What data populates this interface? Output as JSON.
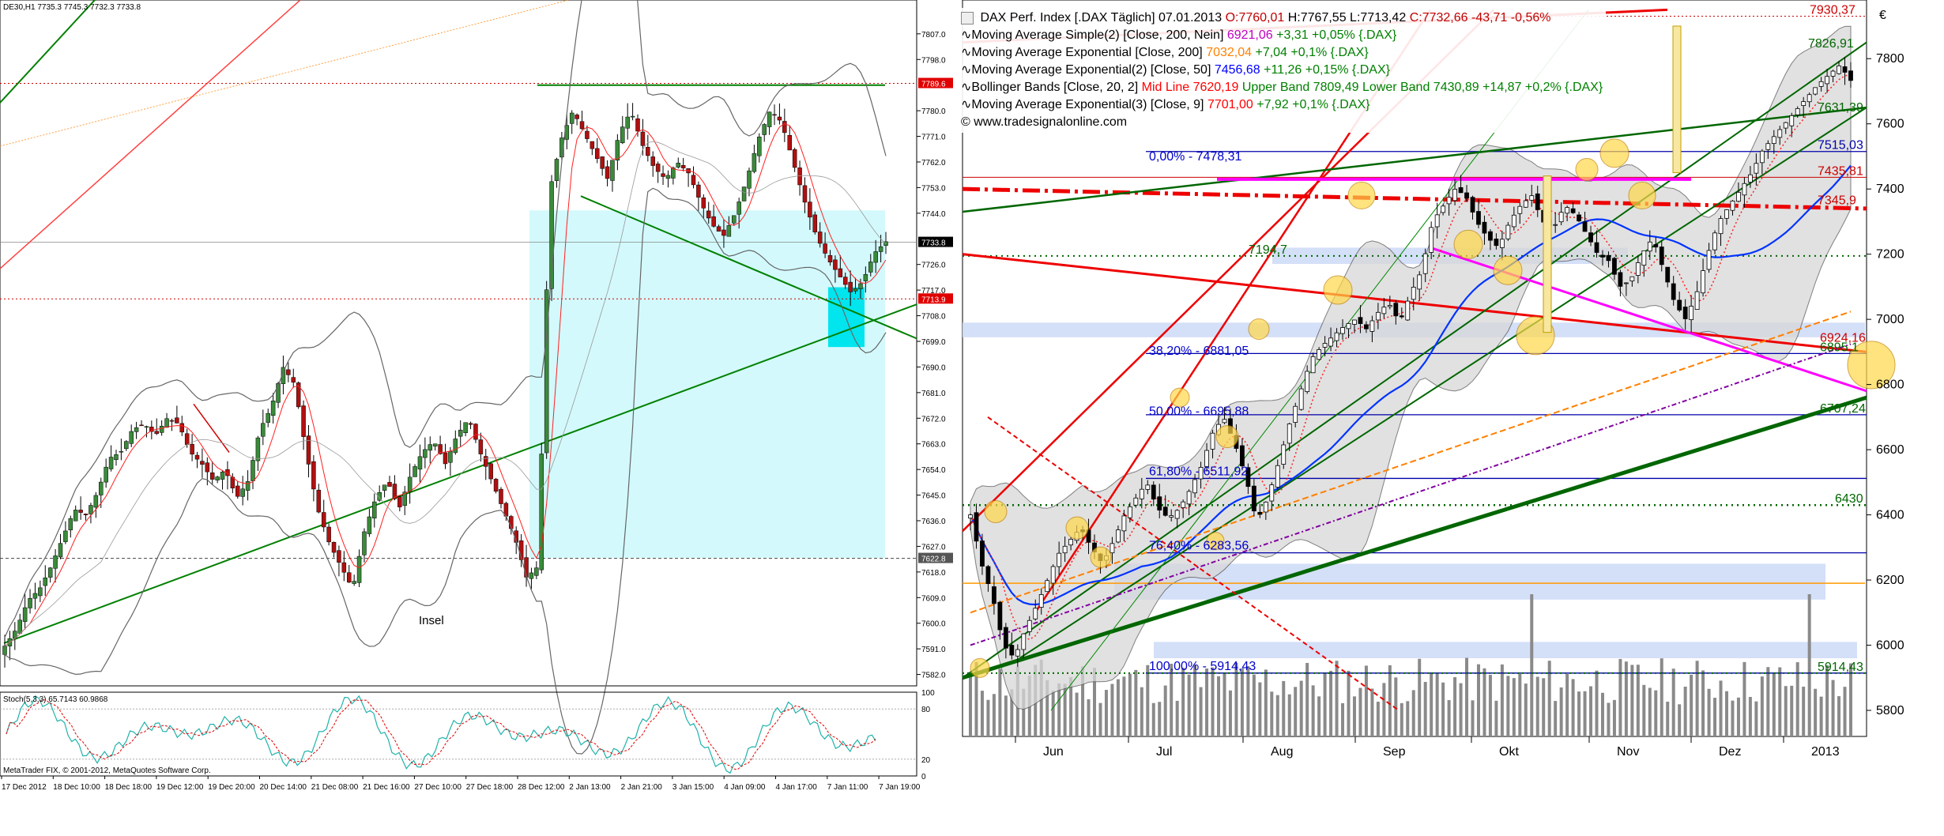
{
  "left": {
    "header": "DE30,H1  7735.3 7745.3 7732.3 7733.8",
    "annotation_insel": "Insel",
    "copyright": "MetaTrader FIX, © 2001-2012, MetaQuotes Software Corp.",
    "stoch_label": "Stoch(5,3,3) 65.7143 60.9868",
    "current_price_tag": "7733.8",
    "red_tag_top": "7789.6",
    "red_tag_mid": "7713.9",
    "gray_tag_low": "7622.8",
    "stoch_ticks": [
      "100",
      "80",
      "20",
      "0"
    ]
  },
  "right": {
    "legend_title": "DAX Perf. Index [.DAX  Täglich]  07.01.2013",
    "legend_ohlc": {
      "o": "O:7760,01",
      "h": "H:7767,55",
      "l": "L:7713,42",
      "c": "C:7732,66",
      "chg": "-43,71 -0,56%"
    },
    "legend_lines": [
      {
        "name": "Moving Average Simple(2) [Close, 200, Nein]",
        "value": "6921,06",
        "chg": "+3,31 +0,05% {.DAX}",
        "color": "#c000c0"
      },
      {
        "name": "Moving Average Exponential [Close, 200]",
        "value": "7032,04",
        "chg": "+7,04 +0,1% {.DAX}",
        "color": "#ff8000"
      },
      {
        "name": "Moving Average Exponential(2) [Close, 50]",
        "value": "7456,68",
        "chg": "+11,26 +0,15% {.DAX}",
        "color": "#0000ff"
      },
      {
        "name": "Bollinger Bands [Close, 20, 2]",
        "value": "Mid Line 7620,19",
        "chg": "Upper Band 7809,49 Lower Band 7430,89 +14,87 +0,2% {.DAX}",
        "color": "#ff0000"
      },
      {
        "name": "Moving Average Exponential(3) [Close, 9]",
        "value": "7701,00",
        "chg": "+7,92 +0,1% {.DAX}",
        "color": "#ff0000"
      }
    ],
    "website": "www.tradesignalonline.com",
    "euro": "€",
    "level_labels": [
      {
        "text": "7930,37",
        "color": "#cc0000"
      },
      {
        "text": "7826,91",
        "color": "#006600"
      },
      {
        "text": "7631,39",
        "color": "#006600"
      },
      {
        "text": "7515,03",
        "color": "#0000aa"
      },
      {
        "text": "7435,81",
        "color": "#cc0000"
      },
      {
        "text": "7345,9",
        "color": "#cc0000"
      },
      {
        "text": "6924,16",
        "color": "#cc0000"
      },
      {
        "text": "6895,1",
        "color": "#006600"
      },
      {
        "text": "6707,24",
        "color": "#006600"
      },
      {
        "text": "6430",
        "color": "#006600"
      },
      {
        "text": "5914,43",
        "color": "#006600"
      },
      {
        "text": "7194,7",
        "color": "#006600"
      }
    ],
    "fib_labels": [
      "0,00% - 7478,31",
      "38,20% - 6881,05",
      "50,00% - 6695,88",
      "61,80% - 6511,92",
      "76,40% - 6283,56",
      "100,00% - 5914,43"
    ]
  },
  "chart_data": [
    {
      "type": "candlestick",
      "title": "DE30,H1",
      "x_labels": [
        "17 Dec 2012",
        "18 Dec 10:00",
        "18 Dec 18:00",
        "19 Dec 12:00",
        "19 Dec 20:00",
        "20 Dec 14:00",
        "21 Dec 08:00",
        "21 Dec 16:00",
        "27 Dec 10:00",
        "27 Dec 18:00",
        "28 Dec 12:00",
        "2 Jan 13:00",
        "2 Jan 21:00",
        "3 Jan 15:00",
        "4 Jan 09:00",
        "4 Jan 17:00",
        "7 Jan 11:00",
        "7 Jan 19:00"
      ],
      "y_ticks": [
        7807.0,
        7798.0,
        7789.6,
        7780.0,
        7771.0,
        7762.0,
        7753.0,
        7744.0,
        7733.8,
        7726.0,
        7717.0,
        7713.9,
        7708.0,
        7699.0,
        7690.0,
        7681.0,
        7672.0,
        7663.0,
        7654.0,
        7645.0,
        7636.0,
        7627.0,
        7622.8,
        7618.0,
        7609.0,
        7600.0,
        7591.0,
        7582.0
      ],
      "ylim": [
        7578,
        7815
      ],
      "close_path": [
        7592,
        7598,
        7608,
        7612,
        7620,
        7630,
        7640,
        7638,
        7646,
        7658,
        7660,
        7668,
        7670,
        7666,
        7672,
        7670,
        7660,
        7656,
        7650,
        7654,
        7644,
        7650,
        7668,
        7676,
        7690,
        7684,
        7660,
        7640,
        7628,
        7620,
        7612,
        7632,
        7644,
        7650,
        7640,
        7652,
        7660,
        7664,
        7656,
        7666,
        7672,
        7660,
        7650,
        7640,
        7630,
        7616,
        7620,
        7752,
        7770,
        7780,
        7772,
        7764,
        7756,
        7772,
        7780,
        7768,
        7760,
        7756,
        7762,
        7758,
        7748,
        7740,
        7736,
        7744,
        7756,
        7770,
        7780,
        7776,
        7762,
        7748,
        7736,
        7728,
        7722,
        7716,
        7720,
        7730,
        7734
      ]
    },
    {
      "type": "stochastic",
      "label": "Stoch(5,3,3) 65.7143 60.9868",
      "y_ticks": [
        100,
        80,
        20,
        0
      ]
    },
    {
      "type": "candlestick",
      "title": "DAX Perf. Index [.DAX  Täglich]",
      "x_labels": [
        "Jun",
        "Jul",
        "Aug",
        "Sep",
        "Okt",
        "Nov",
        "Dez",
        "2013"
      ],
      "y_ticks": [
        7800,
        7600,
        7400,
        7200,
        7000,
        6800,
        6600,
        6400,
        6200,
        6000,
        5800
      ],
      "ylim": [
        5720,
        7980
      ],
      "close_path": [
        6400,
        6250,
        6150,
        6000,
        5960,
        6050,
        6120,
        6200,
        6280,
        6320,
        6360,
        6300,
        6250,
        6320,
        6400,
        6450,
        6500,
        6420,
        6390,
        6420,
        6480,
        6550,
        6650,
        6700,
        6620,
        6520,
        6380,
        6450,
        6560,
        6680,
        6780,
        6880,
        6920,
        6950,
        6980,
        7000,
        6970,
        7020,
        7050,
        6990,
        7080,
        7150,
        7300,
        7350,
        7400,
        7380,
        7300,
        7250,
        7220,
        7300,
        7350,
        7380,
        7300,
        7280,
        7350,
        7320,
        7260,
        7200,
        7180,
        7100,
        7120,
        7200,
        7250,
        7150,
        7050,
        7000,
        7080,
        7200,
        7300,
        7350,
        7400,
        7450,
        7520,
        7560,
        7600,
        7640,
        7680,
        7720,
        7750,
        7780,
        7733
      ]
    }
  ]
}
